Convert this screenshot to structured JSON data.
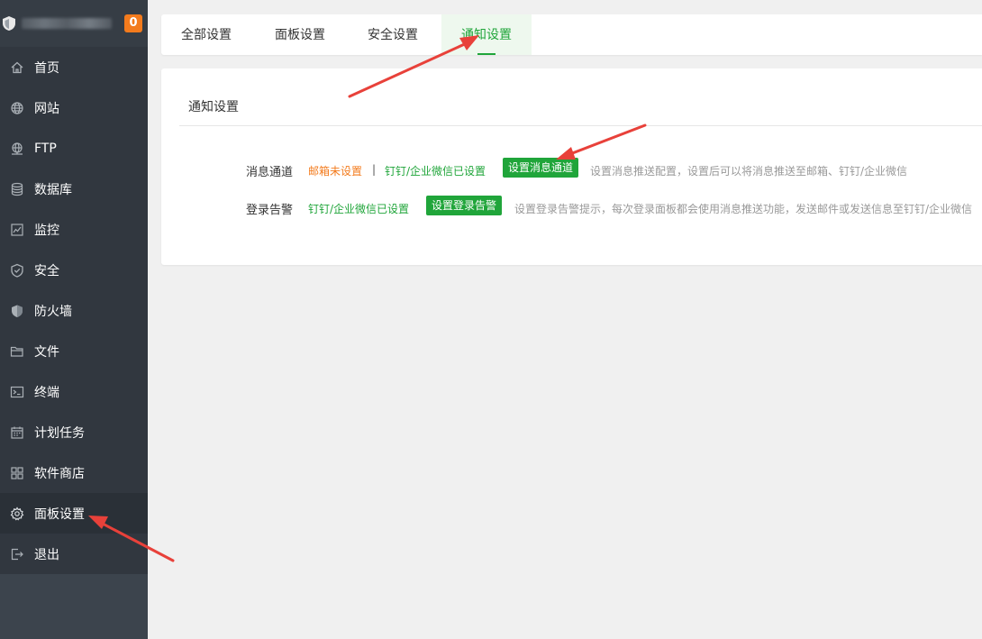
{
  "sidebar": {
    "message_count": "0",
    "items": [
      {
        "label": "首页",
        "icon": "home-icon"
      },
      {
        "label": "网站",
        "icon": "globe-icon"
      },
      {
        "label": "FTP",
        "icon": "ftp-icon"
      },
      {
        "label": "数据库",
        "icon": "database-icon"
      },
      {
        "label": "监控",
        "icon": "monitor-icon"
      },
      {
        "label": "安全",
        "icon": "shield-icon"
      },
      {
        "label": "防火墙",
        "icon": "firewall-icon"
      },
      {
        "label": "文件",
        "icon": "folder-icon"
      },
      {
        "label": "终端",
        "icon": "terminal-icon"
      },
      {
        "label": "计划任务",
        "icon": "calendar-icon"
      },
      {
        "label": "软件商店",
        "icon": "apps-icon"
      },
      {
        "label": "面板设置",
        "icon": "gear-icon",
        "active": true
      },
      {
        "label": "退出",
        "icon": "logout-icon"
      }
    ]
  },
  "tabs": [
    {
      "label": "全部设置"
    },
    {
      "label": "面板设置"
    },
    {
      "label": "安全设置"
    },
    {
      "label": "通知设置",
      "active": true
    }
  ],
  "section": {
    "title": "通知设置",
    "rows": [
      {
        "label": "消息通道",
        "status_email": "邮箱未设置",
        "separator": "|",
        "status_dingtalk": "钉钉/企业微信已设置",
        "button": "设置消息通道",
        "hint": "设置消息推送配置，设置后可以将消息推送至邮箱、钉钉/企业微信"
      },
      {
        "label": "登录告警",
        "status_dingtalk": "钉钉/企业微信已设置",
        "button": "设置登录告警",
        "hint": "设置登录告警提示，每次登录面板都会使用消息推送功能，发送邮件或发送信息至钉钉/企业微信"
      }
    ]
  },
  "colors": {
    "accent_green": "#20a53a",
    "warning_orange": "#f37b1d",
    "sidebar_bg": "#3c444d",
    "annotation_red": "#e8413a"
  }
}
